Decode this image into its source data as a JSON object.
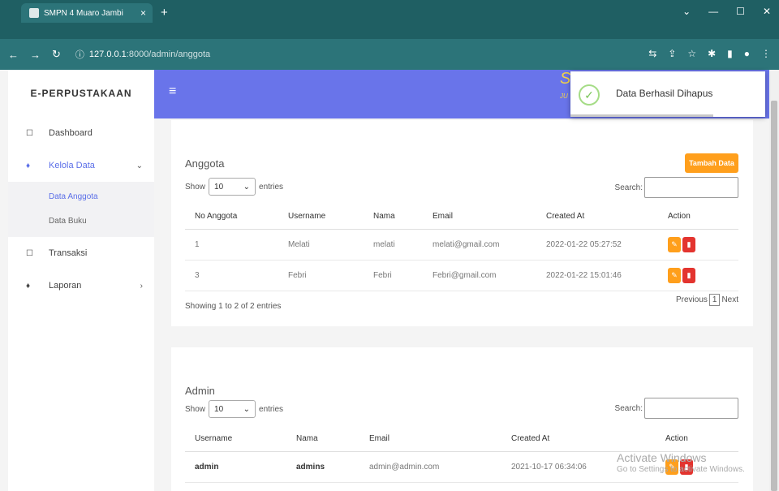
{
  "browser": {
    "tab_title": "SMPN 4 Muaro Jambi",
    "tab_close": "×",
    "new_tab": "+",
    "url_host": "127.0.0.1",
    "url_path": ":8000/admin/anggota"
  },
  "sidebar": {
    "brand": "E-PERPUSTAKAAN",
    "items": [
      {
        "label": "Dashboard"
      },
      {
        "label": "Kelola Data"
      },
      {
        "label": "Transaksi"
      },
      {
        "label": "Laporan"
      }
    ],
    "subitems": [
      {
        "label": "Data Anggota"
      },
      {
        "label": "Data Buku"
      }
    ]
  },
  "topbar": {
    "logo_s": "S",
    "logo_j": "JU"
  },
  "anggota": {
    "title": "Anggota",
    "add_button": "Tambah Data",
    "show_label": "Show",
    "entries_value": "10",
    "entries_label": "entries",
    "search_label": "Search:",
    "columns": [
      "No Anggota",
      "Username",
      "Nama",
      "Email",
      "Created At",
      "Action"
    ],
    "rows": [
      {
        "no": "1",
        "username": "Melati",
        "nama": "melati",
        "email": "melati@gmail.com",
        "created": "2022-01-22 05:27:52"
      },
      {
        "no": "3",
        "username": "Febri",
        "nama": "Febri",
        "email": "Febri@gmail.com",
        "created": "2022-01-22 15:01:46"
      }
    ],
    "info": "Showing 1 to 2 of 2 entries",
    "pager": {
      "prev": "Previous",
      "page": "1",
      "next": "Next"
    }
  },
  "admin": {
    "title": "Admin",
    "show_label": "Show",
    "entries_value": "10",
    "entries_label": "entries",
    "search_label": "Search:",
    "columns": [
      "Username",
      "Nama",
      "Email",
      "Created At",
      "Action"
    ],
    "rows": [
      {
        "username": "admin",
        "nama": "admins",
        "email": "admin@admin.com",
        "created": "2021-10-17 06:34:06"
      }
    ]
  },
  "toast": {
    "message": "Data Berhasil Dihapus"
  },
  "watermark": {
    "line1": "Activate Windows",
    "line2": "Go to Settings to activate Windows."
  },
  "colors": {
    "accent": "#6974ea",
    "warning": "#ff9f1c",
    "danger": "#e3342f",
    "browser": "#2c7479"
  }
}
